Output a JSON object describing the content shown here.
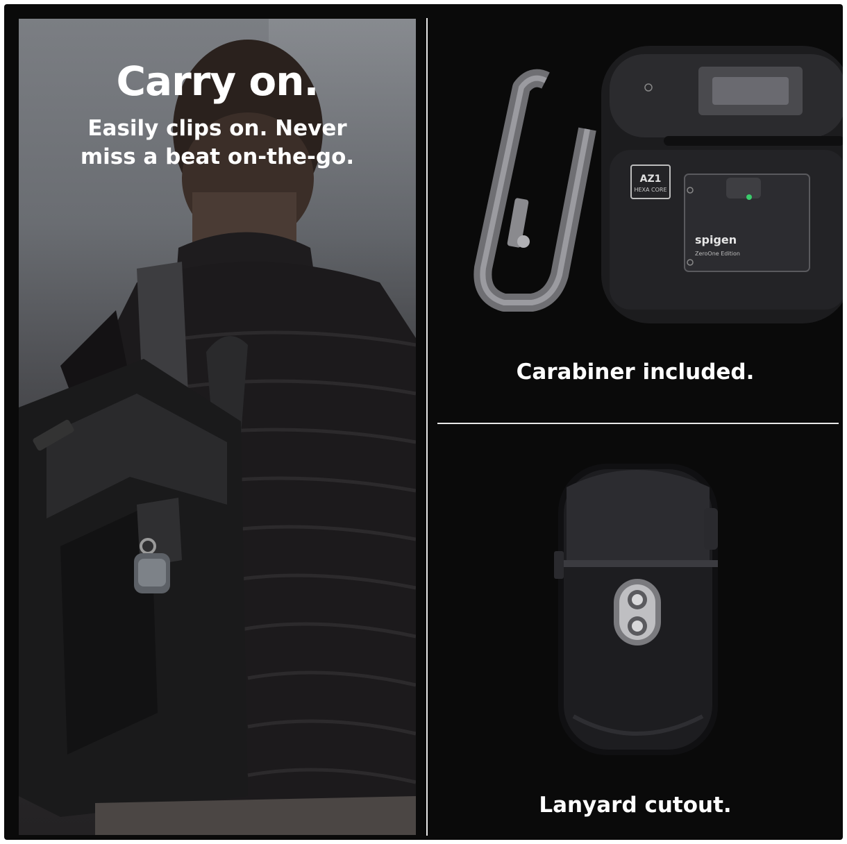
{
  "left_panel": {
    "headline": "Carry on.",
    "subline_1": "Easily clips on. Never",
    "subline_2": "miss a beat on-the-go."
  },
  "top_right": {
    "brand_logo": "spigen",
    "chip_label_1": "AZ1",
    "chip_label_2": "HEXA CORE",
    "edition_label": "ZeroOne Edition",
    "caption": "Carabiner included."
  },
  "bottom_right": {
    "caption": "Lanyard cutout."
  },
  "colors": {
    "background": "#0a0a0a",
    "divider": "#e8e8e8",
    "text": "#ffffff"
  }
}
